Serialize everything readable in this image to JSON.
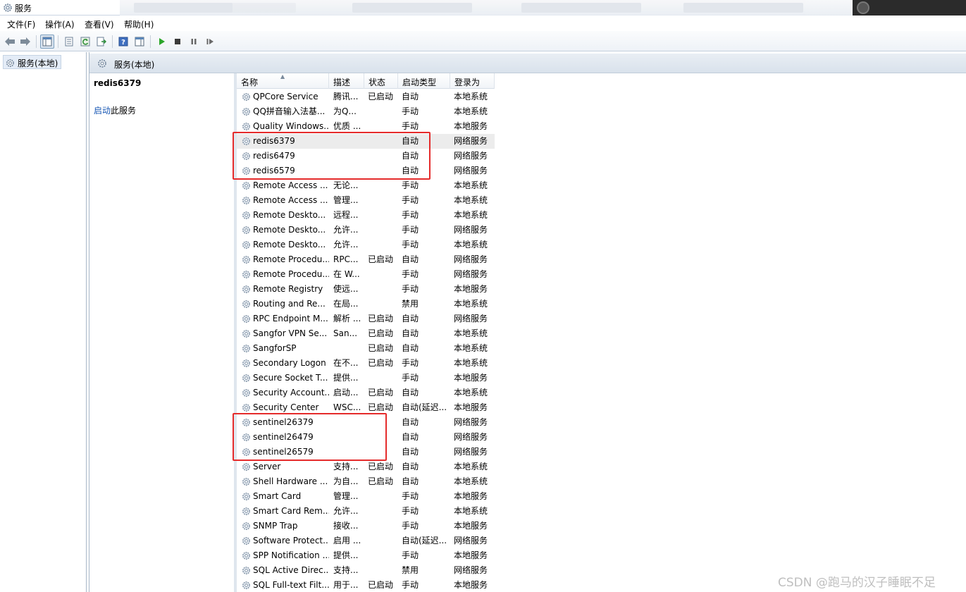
{
  "window": {
    "title": "服务"
  },
  "menubar": [
    {
      "label": "文件(F)"
    },
    {
      "label": "操作(A)"
    },
    {
      "label": "查看(V)"
    },
    {
      "label": "帮助(H)"
    }
  ],
  "toolbar_icons": [
    "back-icon",
    "forward-icon",
    "console-tree-icon",
    "properties-icon",
    "refresh-icon",
    "export-list-icon",
    "help-icon",
    "action-pane-icon",
    "start-icon",
    "stop-icon",
    "pause-icon",
    "resume-icon"
  ],
  "tree": {
    "node_label": "服务(本地)"
  },
  "header": {
    "title": "服务(本地)"
  },
  "description": {
    "selected_service": "redis6379",
    "action_link": "启动",
    "action_suffix": "此服务"
  },
  "columns": {
    "name": "名称",
    "desc": "描述",
    "status": "状态",
    "startup": "启动类型",
    "logon": "登录为"
  },
  "selected_index": 3,
  "services": [
    {
      "name": "QPCore Service",
      "desc": "腾讯...",
      "status": "已启动",
      "startup": "自动",
      "logon": "本地系统"
    },
    {
      "name": "QQ拼音输入法基...",
      "desc": "为Q...",
      "status": "",
      "startup": "手动",
      "logon": "本地系统"
    },
    {
      "name": "Quality Windows...",
      "desc": "优质 ...",
      "status": "",
      "startup": "手动",
      "logon": "本地服务"
    },
    {
      "name": "redis6379",
      "desc": "",
      "status": "",
      "startup": "自动",
      "logon": "网络服务"
    },
    {
      "name": "redis6479",
      "desc": "",
      "status": "",
      "startup": "自动",
      "logon": "网络服务"
    },
    {
      "name": "redis6579",
      "desc": "",
      "status": "",
      "startup": "自动",
      "logon": "网络服务"
    },
    {
      "name": "Remote Access ...",
      "desc": "无论...",
      "status": "",
      "startup": "手动",
      "logon": "本地系统"
    },
    {
      "name": "Remote Access ...",
      "desc": "管理...",
      "status": "",
      "startup": "手动",
      "logon": "本地系统"
    },
    {
      "name": "Remote Deskto...",
      "desc": "远程...",
      "status": "",
      "startup": "手动",
      "logon": "本地系统"
    },
    {
      "name": "Remote Deskto...",
      "desc": "允许...",
      "status": "",
      "startup": "手动",
      "logon": "网络服务"
    },
    {
      "name": "Remote Deskto...",
      "desc": "允许...",
      "status": "",
      "startup": "手动",
      "logon": "本地系统"
    },
    {
      "name": "Remote Procedu...",
      "desc": "RPC...",
      "status": "已启动",
      "startup": "自动",
      "logon": "网络服务"
    },
    {
      "name": "Remote Procedu...",
      "desc": "在 W...",
      "status": "",
      "startup": "手动",
      "logon": "网络服务"
    },
    {
      "name": "Remote Registry",
      "desc": "使远...",
      "status": "",
      "startup": "手动",
      "logon": "本地服务"
    },
    {
      "name": "Routing and Re...",
      "desc": "在局...",
      "status": "",
      "startup": "禁用",
      "logon": "本地系统"
    },
    {
      "name": "RPC Endpoint M...",
      "desc": "解析 ...",
      "status": "已启动",
      "startup": "自动",
      "logon": "网络服务"
    },
    {
      "name": "Sangfor VPN Se...",
      "desc": "San...",
      "status": "已启动",
      "startup": "自动",
      "logon": "本地系统"
    },
    {
      "name": "SangforSP",
      "desc": "",
      "status": "已启动",
      "startup": "自动",
      "logon": "本地系统"
    },
    {
      "name": "Secondary Logon",
      "desc": "在不...",
      "status": "已启动",
      "startup": "手动",
      "logon": "本地系统"
    },
    {
      "name": "Secure Socket T...",
      "desc": "提供...",
      "status": "",
      "startup": "手动",
      "logon": "本地服务"
    },
    {
      "name": "Security Account...",
      "desc": "启动...",
      "status": "已启动",
      "startup": "自动",
      "logon": "本地系统"
    },
    {
      "name": "Security Center",
      "desc": "WSC...",
      "status": "已启动",
      "startup": "自动(延迟...",
      "logon": "本地服务"
    },
    {
      "name": "sentinel26379",
      "desc": "",
      "status": "",
      "startup": "自动",
      "logon": "网络服务"
    },
    {
      "name": "sentinel26479",
      "desc": "",
      "status": "",
      "startup": "自动",
      "logon": "网络服务"
    },
    {
      "name": "sentinel26579",
      "desc": "",
      "status": "",
      "startup": "自动",
      "logon": "网络服务"
    },
    {
      "name": "Server",
      "desc": "支持...",
      "status": "已启动",
      "startup": "自动",
      "logon": "本地系统"
    },
    {
      "name": "Shell Hardware ...",
      "desc": "为自...",
      "status": "已启动",
      "startup": "自动",
      "logon": "本地系统"
    },
    {
      "name": "Smart Card",
      "desc": "管理...",
      "status": "",
      "startup": "手动",
      "logon": "本地服务"
    },
    {
      "name": "Smart Card Rem...",
      "desc": "允许...",
      "status": "",
      "startup": "手动",
      "logon": "本地系统"
    },
    {
      "name": "SNMP Trap",
      "desc": "接收...",
      "status": "",
      "startup": "手动",
      "logon": "本地服务"
    },
    {
      "name": "Software Protect...",
      "desc": "启用 ...",
      "status": "",
      "startup": "自动(延迟...",
      "logon": "网络服务"
    },
    {
      "name": "SPP Notification ...",
      "desc": "提供...",
      "status": "",
      "startup": "手动",
      "logon": "本地服务"
    },
    {
      "name": "SQL Active Direc...",
      "desc": "支持...",
      "status": "",
      "startup": "禁用",
      "logon": "网络服务"
    },
    {
      "name": "SQL Full-text Filt...",
      "desc": "用于...",
      "status": "已启动",
      "startup": "手动",
      "logon": "本地服务"
    }
  ],
  "highlights": [
    {
      "first_row": 3,
      "last_row": 5,
      "color": "#e52b2b"
    },
    {
      "first_row": 22,
      "last_row": 24,
      "color": "#e52b2b"
    }
  ],
  "watermark": "CSDN @跑马的汉子睡眠不足"
}
